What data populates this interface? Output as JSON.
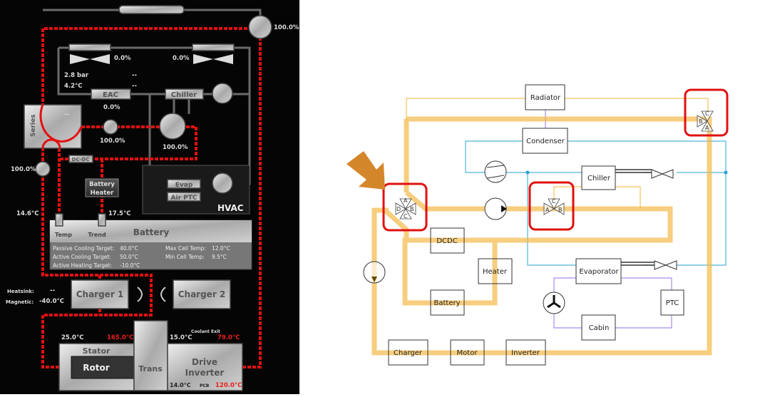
{
  "dashboard": {
    "radiator_fan_pct": "100.0%",
    "fan_left_pct": "0.0%",
    "fan_right_pct": "0.0%",
    "pressure": "2.8 bar",
    "pressure_b": "--",
    "temp": "4.2°C",
    "temp_b": "--",
    "eac_label": "EAC",
    "eac_pct": "0.0%",
    "chiller_label": "Chiller",
    "series_label": "Series",
    "series_value": "--",
    "pump_pct": "100.0%",
    "chiller_pump_pct": "100.0%",
    "left_pump_pct": "100.0%",
    "dcdc_label": "DC-DC",
    "battery_heater_label": [
      "Battery",
      "Heater"
    ],
    "evap_label": "Evap",
    "air_ptc_label": "Air PTC",
    "hvac_label": "HVAC",
    "battery_in_temp": "14.6°C",
    "battery_out_temp": "17.5°C",
    "battery": {
      "title": "Battery",
      "temp_label": "Temp",
      "trend_label": "Trend",
      "passive_label": "Passive Cooling Target:",
      "passive": "40.0°C",
      "active_cool_label": "Active Cooling Target:",
      "active_cool": "50.0°C",
      "active_heat_label": "Active Heating Target:",
      "active_heat": "-10.0°C",
      "max_cell_label": "Max Cell Temp:",
      "max_cell": "12.0°C",
      "min_cell_label": "Min Cell Temp:",
      "min_cell": "9.5°C"
    },
    "heatsink_label": "Heatsink:",
    "heatsink": "--",
    "magnetic_label": "Magnetic:",
    "magnetic": "-40.0°C",
    "charger1": "Charger 1",
    "charger2": "Charger 2",
    "stator_temp": "25.0°C",
    "rotor_temp": "165.0°C",
    "inverter_in_temp": "15.0°C",
    "coolant_exit_label": "Coolant Exit",
    "coolant_exit": "79.0°C",
    "stator": "Stator",
    "rotor": "Rotor",
    "trans": "Trans",
    "drive_inverter": [
      "Drive",
      "Inverter"
    ],
    "inverter_temp": "14.0°C",
    "pcb_label": "PCB",
    "pcb_temp": "120.0°C",
    "colors": {
      "coolant": "#e31010"
    }
  },
  "schematic": {
    "blocks": {
      "radiator": "Radiator",
      "condenser": "Condenser",
      "chiller": "Chiller",
      "dcdc": "DCDC",
      "heater": "Heater",
      "battery": "Battery",
      "evaporator": "Evaporator",
      "ptc": "PTC",
      "cabin": "Cabin",
      "charger": "Charger",
      "motor": "Motor",
      "inverter": "Inverter"
    },
    "valve4_ports": [
      "A",
      "B",
      "C",
      "D"
    ],
    "valve3_ports": [
      "A",
      "B",
      "C"
    ],
    "colors": {
      "coolant": "#f2b43a",
      "refrigerant": "#4fb3dc",
      "air": "#a98cf0",
      "highlight": "#e01010",
      "arrow": "#d4862a"
    }
  }
}
